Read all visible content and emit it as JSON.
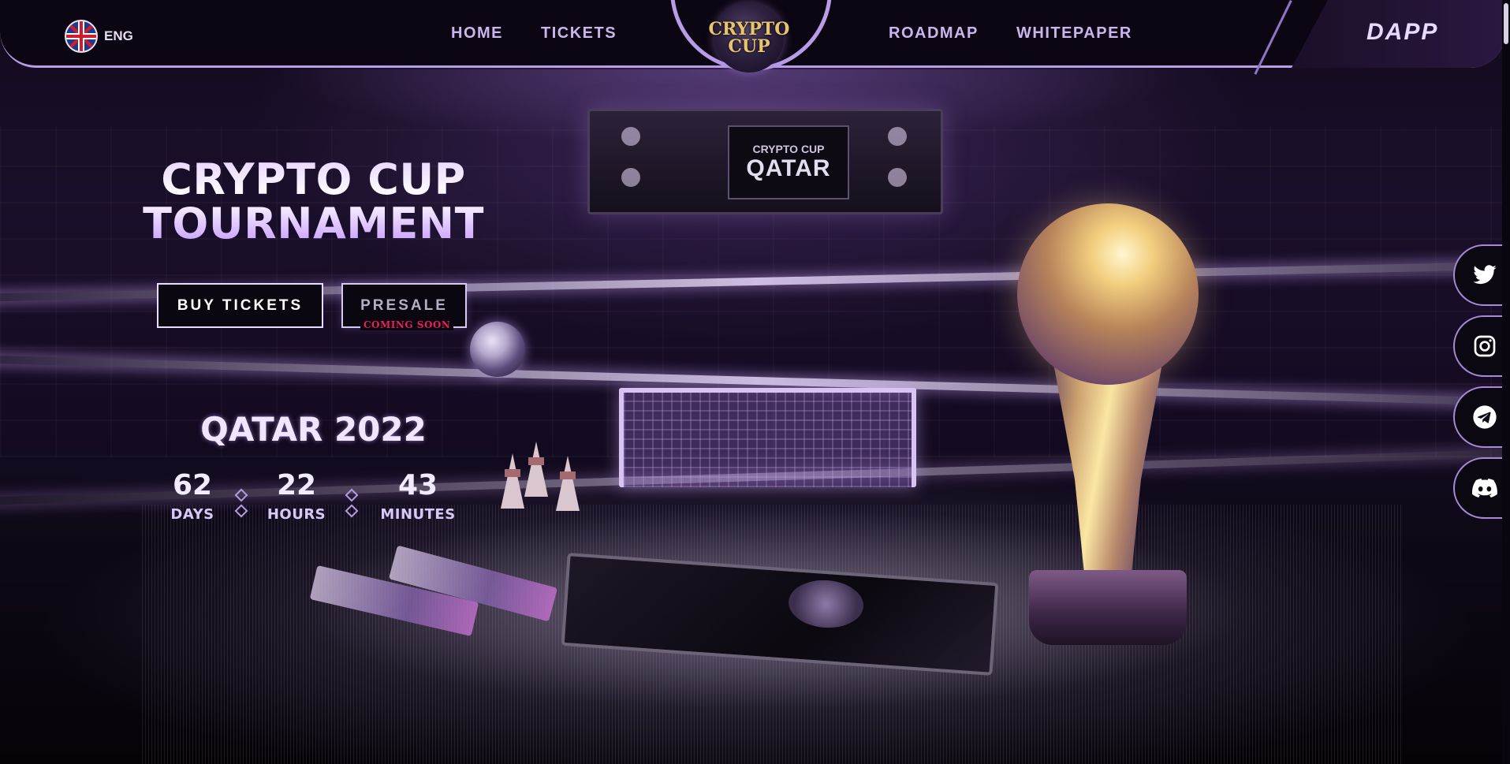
{
  "header": {
    "language": "ENG",
    "nav_left": [
      "HOME",
      "TICKETS"
    ],
    "nav_right": [
      "ROADMAP",
      "WHITEPAPER"
    ],
    "logo_line1": "CRYPTO",
    "logo_line2": "CUP",
    "dapp_label": "DAPP"
  },
  "hero": {
    "title_line1": "CRYPTO CUP",
    "title_line2": "TOURNAMENT",
    "buy_tickets": "BUY TICKETS",
    "presale": "PRESALE",
    "presale_note": "COMING SOON",
    "event_name": "QATAR 2022"
  },
  "countdown": [
    {
      "value": "62",
      "label": "DAYS"
    },
    {
      "value": "22",
      "label": "HOURS"
    },
    {
      "value": "43",
      "label": "MINUTES"
    }
  ],
  "scoreboard": {
    "small": "CRYPTO CUP",
    "big": "QATAR"
  },
  "socials": [
    {
      "icon": "twitter-icon"
    },
    {
      "icon": "instagram-icon"
    },
    {
      "icon": "telegram-icon"
    },
    {
      "icon": "discord-icon"
    }
  ],
  "colors": {
    "accent": "#b79ce6",
    "background": "#0c0613",
    "presale_note": "#e6215a"
  }
}
